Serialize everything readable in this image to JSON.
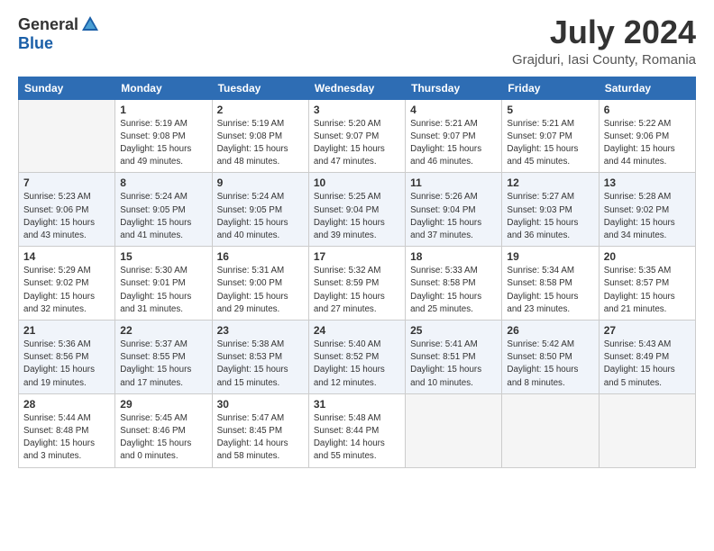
{
  "header": {
    "logo": {
      "general": "General",
      "blue": "Blue"
    },
    "title": "July 2024",
    "location": "Grajduri, Iasi County, Romania"
  },
  "calendar": {
    "days_of_week": [
      "Sunday",
      "Monday",
      "Tuesday",
      "Wednesday",
      "Thursday",
      "Friday",
      "Saturday"
    ],
    "weeks": [
      [
        {
          "day": "",
          "info": ""
        },
        {
          "day": "1",
          "info": "Sunrise: 5:19 AM\nSunset: 9:08 PM\nDaylight: 15 hours\nand 49 minutes."
        },
        {
          "day": "2",
          "info": "Sunrise: 5:19 AM\nSunset: 9:08 PM\nDaylight: 15 hours\nand 48 minutes."
        },
        {
          "day": "3",
          "info": "Sunrise: 5:20 AM\nSunset: 9:07 PM\nDaylight: 15 hours\nand 47 minutes."
        },
        {
          "day": "4",
          "info": "Sunrise: 5:21 AM\nSunset: 9:07 PM\nDaylight: 15 hours\nand 46 minutes."
        },
        {
          "day": "5",
          "info": "Sunrise: 5:21 AM\nSunset: 9:07 PM\nDaylight: 15 hours\nand 45 minutes."
        },
        {
          "day": "6",
          "info": "Sunrise: 5:22 AM\nSunset: 9:06 PM\nDaylight: 15 hours\nand 44 minutes."
        }
      ],
      [
        {
          "day": "7",
          "info": "Sunrise: 5:23 AM\nSunset: 9:06 PM\nDaylight: 15 hours\nand 43 minutes."
        },
        {
          "day": "8",
          "info": "Sunrise: 5:24 AM\nSunset: 9:05 PM\nDaylight: 15 hours\nand 41 minutes."
        },
        {
          "day": "9",
          "info": "Sunrise: 5:24 AM\nSunset: 9:05 PM\nDaylight: 15 hours\nand 40 minutes."
        },
        {
          "day": "10",
          "info": "Sunrise: 5:25 AM\nSunset: 9:04 PM\nDaylight: 15 hours\nand 39 minutes."
        },
        {
          "day": "11",
          "info": "Sunrise: 5:26 AM\nSunset: 9:04 PM\nDaylight: 15 hours\nand 37 minutes."
        },
        {
          "day": "12",
          "info": "Sunrise: 5:27 AM\nSunset: 9:03 PM\nDaylight: 15 hours\nand 36 minutes."
        },
        {
          "day": "13",
          "info": "Sunrise: 5:28 AM\nSunset: 9:02 PM\nDaylight: 15 hours\nand 34 minutes."
        }
      ],
      [
        {
          "day": "14",
          "info": "Sunrise: 5:29 AM\nSunset: 9:02 PM\nDaylight: 15 hours\nand 32 minutes."
        },
        {
          "day": "15",
          "info": "Sunrise: 5:30 AM\nSunset: 9:01 PM\nDaylight: 15 hours\nand 31 minutes."
        },
        {
          "day": "16",
          "info": "Sunrise: 5:31 AM\nSunset: 9:00 PM\nDaylight: 15 hours\nand 29 minutes."
        },
        {
          "day": "17",
          "info": "Sunrise: 5:32 AM\nSunset: 8:59 PM\nDaylight: 15 hours\nand 27 minutes."
        },
        {
          "day": "18",
          "info": "Sunrise: 5:33 AM\nSunset: 8:58 PM\nDaylight: 15 hours\nand 25 minutes."
        },
        {
          "day": "19",
          "info": "Sunrise: 5:34 AM\nSunset: 8:58 PM\nDaylight: 15 hours\nand 23 minutes."
        },
        {
          "day": "20",
          "info": "Sunrise: 5:35 AM\nSunset: 8:57 PM\nDaylight: 15 hours\nand 21 minutes."
        }
      ],
      [
        {
          "day": "21",
          "info": "Sunrise: 5:36 AM\nSunset: 8:56 PM\nDaylight: 15 hours\nand 19 minutes."
        },
        {
          "day": "22",
          "info": "Sunrise: 5:37 AM\nSunset: 8:55 PM\nDaylight: 15 hours\nand 17 minutes."
        },
        {
          "day": "23",
          "info": "Sunrise: 5:38 AM\nSunset: 8:53 PM\nDaylight: 15 hours\nand 15 minutes."
        },
        {
          "day": "24",
          "info": "Sunrise: 5:40 AM\nSunset: 8:52 PM\nDaylight: 15 hours\nand 12 minutes."
        },
        {
          "day": "25",
          "info": "Sunrise: 5:41 AM\nSunset: 8:51 PM\nDaylight: 15 hours\nand 10 minutes."
        },
        {
          "day": "26",
          "info": "Sunrise: 5:42 AM\nSunset: 8:50 PM\nDaylight: 15 hours\nand 8 minutes."
        },
        {
          "day": "27",
          "info": "Sunrise: 5:43 AM\nSunset: 8:49 PM\nDaylight: 15 hours\nand 5 minutes."
        }
      ],
      [
        {
          "day": "28",
          "info": "Sunrise: 5:44 AM\nSunset: 8:48 PM\nDaylight: 15 hours\nand 3 minutes."
        },
        {
          "day": "29",
          "info": "Sunrise: 5:45 AM\nSunset: 8:46 PM\nDaylight: 15 hours\nand 0 minutes."
        },
        {
          "day": "30",
          "info": "Sunrise: 5:47 AM\nSunset: 8:45 PM\nDaylight: 14 hours\nand 58 minutes."
        },
        {
          "day": "31",
          "info": "Sunrise: 5:48 AM\nSunset: 8:44 PM\nDaylight: 14 hours\nand 55 minutes."
        },
        {
          "day": "",
          "info": ""
        },
        {
          "day": "",
          "info": ""
        },
        {
          "day": "",
          "info": ""
        }
      ]
    ]
  }
}
